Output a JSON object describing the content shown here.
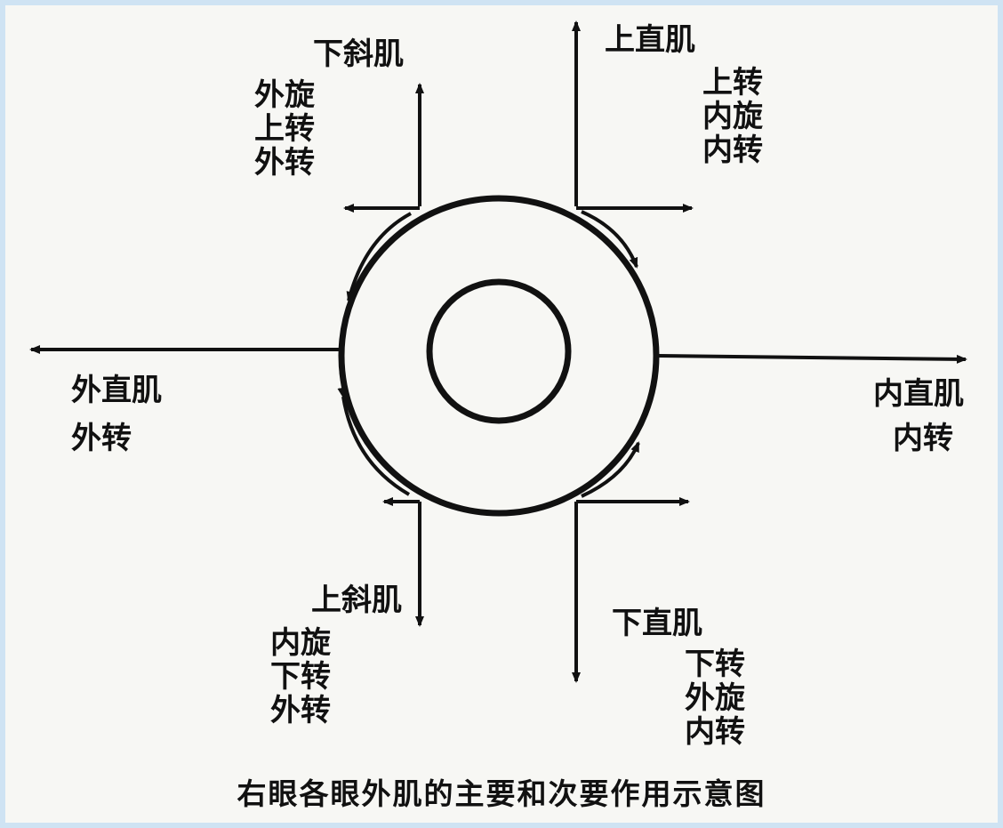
{
  "labels": {
    "inferior_oblique": {
      "name": "下斜肌",
      "actions": [
        "外旋",
        "上转",
        "外转"
      ]
    },
    "superior_rectus": {
      "name": "上直肌",
      "actions": [
        "上转",
        "内旋",
        "内转"
      ]
    },
    "lateral_rectus": {
      "name": "外直肌",
      "actions": [
        "外转"
      ]
    },
    "medial_rectus": {
      "name": "内直肌",
      "actions": [
        "内转"
      ]
    },
    "superior_oblique": {
      "name": "上斜肌",
      "actions": [
        "内旋",
        "下转",
        "外转"
      ]
    },
    "inferior_rectus": {
      "name": "下直肌",
      "actions": [
        "下转",
        "外旋",
        "内转"
      ]
    }
  },
  "caption": "右眼各眼外肌的主要和次要作用示意图",
  "colors": {
    "ink": "#111111",
    "paper": "#f7f7f4",
    "frame": "#cfe3f3"
  }
}
